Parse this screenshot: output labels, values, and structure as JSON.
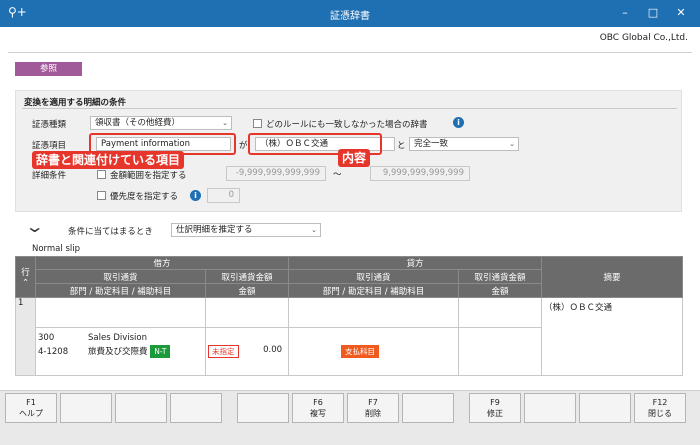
{
  "window": {
    "title": "証憑辞書",
    "company": "OBC Global Co.,Ltd."
  },
  "mode_label": "参照",
  "condition_section": {
    "title": "変換を適用する明細の条件",
    "voucher_type_label": "証憑種類",
    "voucher_type_value": "領収書（その他経費）",
    "no_match_label": "どのルールにも一致しなかった場合の辞書",
    "voucher_item_label": "証憑項目",
    "voucher_item_value": "Payment information",
    "ga": "が",
    "content_value": "（株）ＯＢＣ交通",
    "to": "と",
    "match_value": "完全一致",
    "detail_label": "詳細条件",
    "amount_range_label": "金額範囲を指定する",
    "amount_from": "-9,999,999,999,999",
    "tilde": "～",
    "amount_to": "9,999,999,999,999",
    "priority_label": "優先度を指定する",
    "priority_value": "0"
  },
  "annotations": {
    "dict_item": "辞書と関連付けている項目",
    "content": "内容"
  },
  "when_label": "条件に当てはまるとき",
  "when_value": "仕訳明細を推定する",
  "slip_label": "Normal slip",
  "table": {
    "row_header": "行",
    "debit": "借方",
    "credit": "貸方",
    "currency": "取引通貨",
    "currency_amount": "取引通貨金額",
    "dept_account": "部門 / 勘定科目 / 補助科目",
    "amount": "金額",
    "summary": "摘要",
    "row_no": "1",
    "dept_code": "300",
    "dept_name": "Sales Division",
    "account_code": "4-1208",
    "account_name": "旅費及び交際費",
    "tax_tag": "N-T",
    "unspecified_tag": "未指定",
    "debit_amount": "0.00",
    "credit_tag": "支払科目",
    "summary_value": "（株）ＯＢＣ交通"
  },
  "fkeys": [
    {
      "key": "F1",
      "label": "ヘルプ"
    },
    {
      "key": "",
      "label": ""
    },
    {
      "key": "",
      "label": ""
    },
    {
      "key": "",
      "label": ""
    },
    {
      "key": "",
      "label": ""
    },
    {
      "key": "F6",
      "label": "複写"
    },
    {
      "key": "F7",
      "label": "削除"
    },
    {
      "key": "",
      "label": ""
    },
    {
      "key": "F9",
      "label": "修正"
    },
    {
      "key": "",
      "label": ""
    },
    {
      "key": "",
      "label": ""
    },
    {
      "key": "F12",
      "label": "閉じる"
    }
  ],
  "colors": {
    "titlebar": "#1f6fb3",
    "mode": "#a15a99",
    "annotation": "#e6362b",
    "tax_tag": "#1a9a3a",
    "unspecified": "#e6362b",
    "credit_tag": "#f05a1e"
  }
}
